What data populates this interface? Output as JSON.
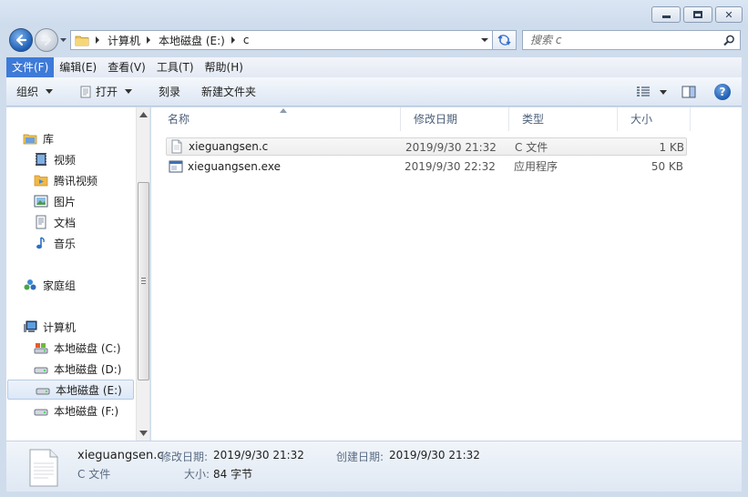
{
  "window": {
    "minimize_label": "",
    "maximize_label": "",
    "close_label": ""
  },
  "address": {
    "crumbs": [
      "计算机",
      "本地磁盘 (E:)",
      "c"
    ]
  },
  "search": {
    "placeholder": "搜索 c"
  },
  "menu": {
    "items": [
      "文件(F)",
      "编辑(E)",
      "查看(V)",
      "工具(T)",
      "帮助(H)"
    ],
    "active_index": 0
  },
  "toolbar": {
    "organize": "组织",
    "open": "打开",
    "burn": "刻录",
    "new_folder": "新建文件夹"
  },
  "nav": {
    "libraries": "库",
    "library_items": [
      "视频",
      "腾讯视频",
      "图片",
      "文档",
      "音乐"
    ],
    "homegroup": "家庭组",
    "computer": "计算机",
    "drives": [
      "本地磁盘 (C:)",
      "本地磁盘 (D:)",
      "本地磁盘 (E:)",
      "本地磁盘 (F:)"
    ],
    "selected_drive": "本地磁盘 (E:)"
  },
  "columns": {
    "name": "名称",
    "modified": "修改日期",
    "type": "类型",
    "size": "大小"
  },
  "files": [
    {
      "name": "xieguangsen.c",
      "modified": "2019/9/30 21:32",
      "type": "C 文件",
      "size": "1 KB",
      "icon": "c-file-icon"
    },
    {
      "name": "xieguangsen.exe",
      "modified": "2019/9/30 22:32",
      "type": "应用程序",
      "size": "50 KB",
      "icon": "exe-file-icon"
    }
  ],
  "details": {
    "filename": "xieguangsen.c",
    "filetype": "C 文件",
    "modified_label": "修改日期:",
    "modified_value": "2019/9/30 21:32",
    "created_label": "创建日期:",
    "created_value": "2019/9/30 21:32",
    "size_label": "大小:",
    "size_value": "84 字节"
  },
  "colors": {
    "menu_active": "#3e7ad8",
    "frame": "#cfdcec"
  }
}
